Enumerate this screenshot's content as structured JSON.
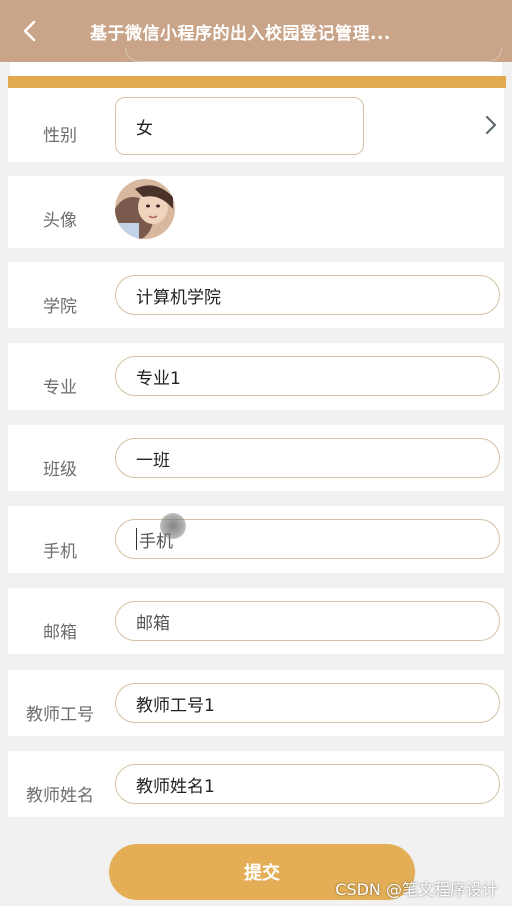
{
  "navbar": {
    "title": "基于微信小程序的出入校园登记管理...",
    "back_icon": "chevron-left-icon"
  },
  "form": {
    "gender": {
      "label": "性别",
      "value": "女"
    },
    "avatar": {
      "label": "头像"
    },
    "college": {
      "label": "学院",
      "value": "计算机学院"
    },
    "major": {
      "label": "专业",
      "value": "专业1"
    },
    "class": {
      "label": "班级",
      "value": "一班"
    },
    "phone": {
      "label": "手机",
      "placeholder": "手机"
    },
    "email": {
      "label": "邮箱",
      "placeholder": "邮箱"
    },
    "teacher_id": {
      "label": "教师工号",
      "value": "教师工号1"
    },
    "teacher_name": {
      "label": "教师姓名",
      "value": "教师姓名1"
    }
  },
  "submit_label": "提交",
  "watermark": "CSDN @笔文程序设计",
  "colors": {
    "navbar": "#c9a488",
    "accent": "#e0ab4f",
    "button": "#e3ae56",
    "field_border": "#d5c1a6"
  }
}
